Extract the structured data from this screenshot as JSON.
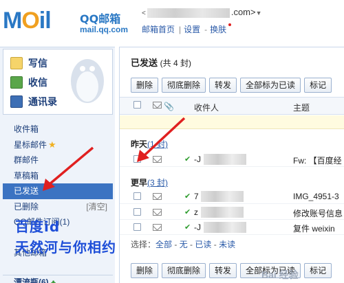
{
  "header": {
    "logo_text": "MOil",
    "logo_brand": "QQ邮箱",
    "logo_domain": "mail.qq.com",
    "account_suffix": ".com>",
    "account_arrow": "▼",
    "links": [
      "邮箱首页",
      "设置",
      "换肤"
    ]
  },
  "sidebar": {
    "compose": "写信",
    "inbox": "收信",
    "contacts": "通讯录",
    "items": [
      {
        "label": "收件箱"
      },
      {
        "label": "星标邮件",
        "icon": "star-icon"
      },
      {
        "label": "群邮件"
      },
      {
        "label": "草稿箱"
      },
      {
        "label": "已发送",
        "active": true
      },
      {
        "label": "已删除",
        "extra": "[清空]"
      },
      {
        "label": "QQ邮件订阅(1)"
      },
      {
        "label": ""
      },
      {
        "label": "其他邮箱"
      }
    ],
    "bottom": "漂流瓶(6)"
  },
  "main": {
    "title": "已发送",
    "count": "(共 4 封)",
    "toolbar": [
      "删除",
      "彻底删除",
      "转发",
      "全部标为已读",
      "标记"
    ],
    "list_head": {
      "sender": "收件人",
      "subject": "主题"
    },
    "groups": [
      {
        "label": "昨天",
        "count_link": "(1 封)"
      },
      {
        "label": "更早",
        "count_link": "(3 封)"
      }
    ],
    "rows": [
      {
        "prefix": "-J",
        "subject": "Fw: 【百度经"
      },
      {
        "prefix": "7",
        "subject": "IMG_4951-3"
      },
      {
        "prefix": "z",
        "subject": "修改账号信息"
      },
      {
        "prefix": "-J",
        "subject": "复件 weixin"
      }
    ],
    "select_bar": {
      "prefix": "选择：",
      "options": [
        "全部",
        "无",
        "已读",
        "未读"
      ]
    }
  },
  "overlay": {
    "line1": "百度id",
    "line2": "天然河与你相约",
    "watermark": "Bai 经验"
  },
  "colors": {
    "accent": "#3b73c2",
    "arrow": "#e02020",
    "overlay": "#1f4fd8"
  }
}
